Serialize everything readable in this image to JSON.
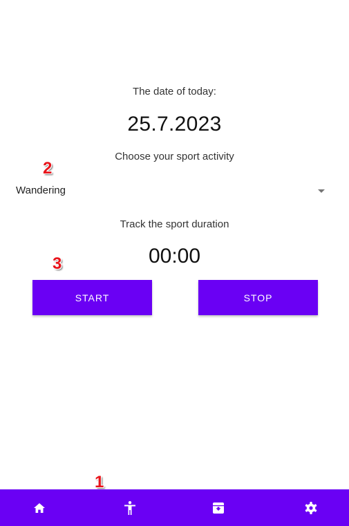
{
  "main": {
    "date_label": "The date of today:",
    "date_value": "25.7.2023",
    "sport_label": "Choose your sport activity",
    "sport_selected": "Wandering",
    "track_label": "Track the sport duration",
    "timer_value": "00:00",
    "start_label": "START",
    "stop_label": "STOP"
  },
  "markers": [
    "1",
    "2",
    "3"
  ],
  "bottom_nav": {
    "items": [
      {
        "icon": "home-icon"
      },
      {
        "icon": "person-icon"
      },
      {
        "icon": "archive-icon"
      },
      {
        "icon": "gear-icon"
      }
    ]
  },
  "colors": {
    "accent": "#6a00f4",
    "marker": "#e8141b"
  }
}
